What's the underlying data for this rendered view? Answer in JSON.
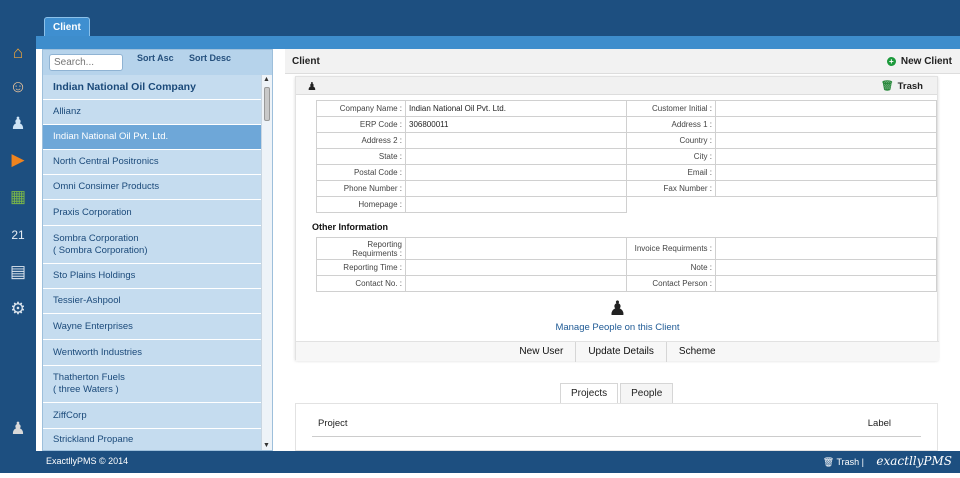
{
  "top_tab": "Client",
  "rail_icons": [
    "home-icon",
    "users-icon",
    "client-icon",
    "projects-icon",
    "reports-icon",
    "calendar-icon",
    "documents-icon",
    "settings-icon",
    "profile-icon"
  ],
  "sidebar": {
    "search_placeholder": "Search...",
    "sort_asc": "Sort Asc",
    "sort_desc": "Sort Desc",
    "items": [
      {
        "label": "Indian National Oil Company",
        "type": "header"
      },
      {
        "label": "Allianz"
      },
      {
        "label": "Indian National Oil  Pvt. Ltd.",
        "type": "selected"
      },
      {
        "label": "North Central Positronics"
      },
      {
        "label": "Omni Consimer Products"
      },
      {
        "label": "Praxis Corporation"
      },
      {
        "label": "Sombra Corporation",
        "sub": "( Sombra Corporation)"
      },
      {
        "label": "Sto Plains Holdings"
      },
      {
        "label": "Tessier-Ashpool"
      },
      {
        "label": "Wayne Enterprises"
      },
      {
        "label": "Wentworth Industries"
      },
      {
        "label": "Thatherton Fuels",
        "sub": "( three Waters )"
      },
      {
        "label": "ZiffCorp"
      },
      {
        "label": "Strickland Propane"
      }
    ]
  },
  "main": {
    "title": "Client",
    "new_client": "New Client",
    "trash": "Trash",
    "fields": [
      [
        {
          "label": "Company Name :",
          "value": "Indian National Oil  Pvt. Ltd."
        },
        {
          "label": "Customer Initial :",
          "value": ""
        }
      ],
      [
        {
          "label": "ERP Code :",
          "value": "306800011"
        },
        {
          "label": "Address 1 :",
          "value": ""
        }
      ],
      [
        {
          "label": "Address 2 :",
          "value": ""
        },
        {
          "label": "Country :",
          "value": ""
        }
      ],
      [
        {
          "label": "State :",
          "value": ""
        },
        {
          "label": "City :",
          "value": ""
        }
      ],
      [
        {
          "label": "Postal Code :",
          "value": ""
        },
        {
          "label": "Email :",
          "value": ""
        }
      ],
      [
        {
          "label": "Phone Number :",
          "value": ""
        },
        {
          "label": "Fax Number :",
          "value": ""
        }
      ],
      [
        {
          "label": "Homepage :",
          "value": ""
        }
      ]
    ],
    "other_title": "Other Information",
    "other_fields": [
      [
        {
          "label": "Reporting Requirments :",
          "value": ""
        },
        {
          "label": "Invoice Requirments :",
          "value": ""
        }
      ],
      [
        {
          "label": "Reporting Time :",
          "value": ""
        },
        {
          "label": "Note :",
          "value": ""
        }
      ],
      [
        {
          "label": "Contact No. :",
          "value": ""
        },
        {
          "label": "Contact Person :",
          "value": ""
        }
      ]
    ],
    "manage_link": "Manage People on this Client",
    "actions": [
      "New User",
      "Update Details",
      "Scheme"
    ],
    "tabs": [
      "Projects",
      "People"
    ],
    "active_tab": "Projects",
    "project_col": "Project",
    "label_col": "Label"
  },
  "footer": {
    "copyright": "ExactllyPMS © 2014",
    "trash": "Trash |",
    "brand": "exactllyPMS"
  }
}
